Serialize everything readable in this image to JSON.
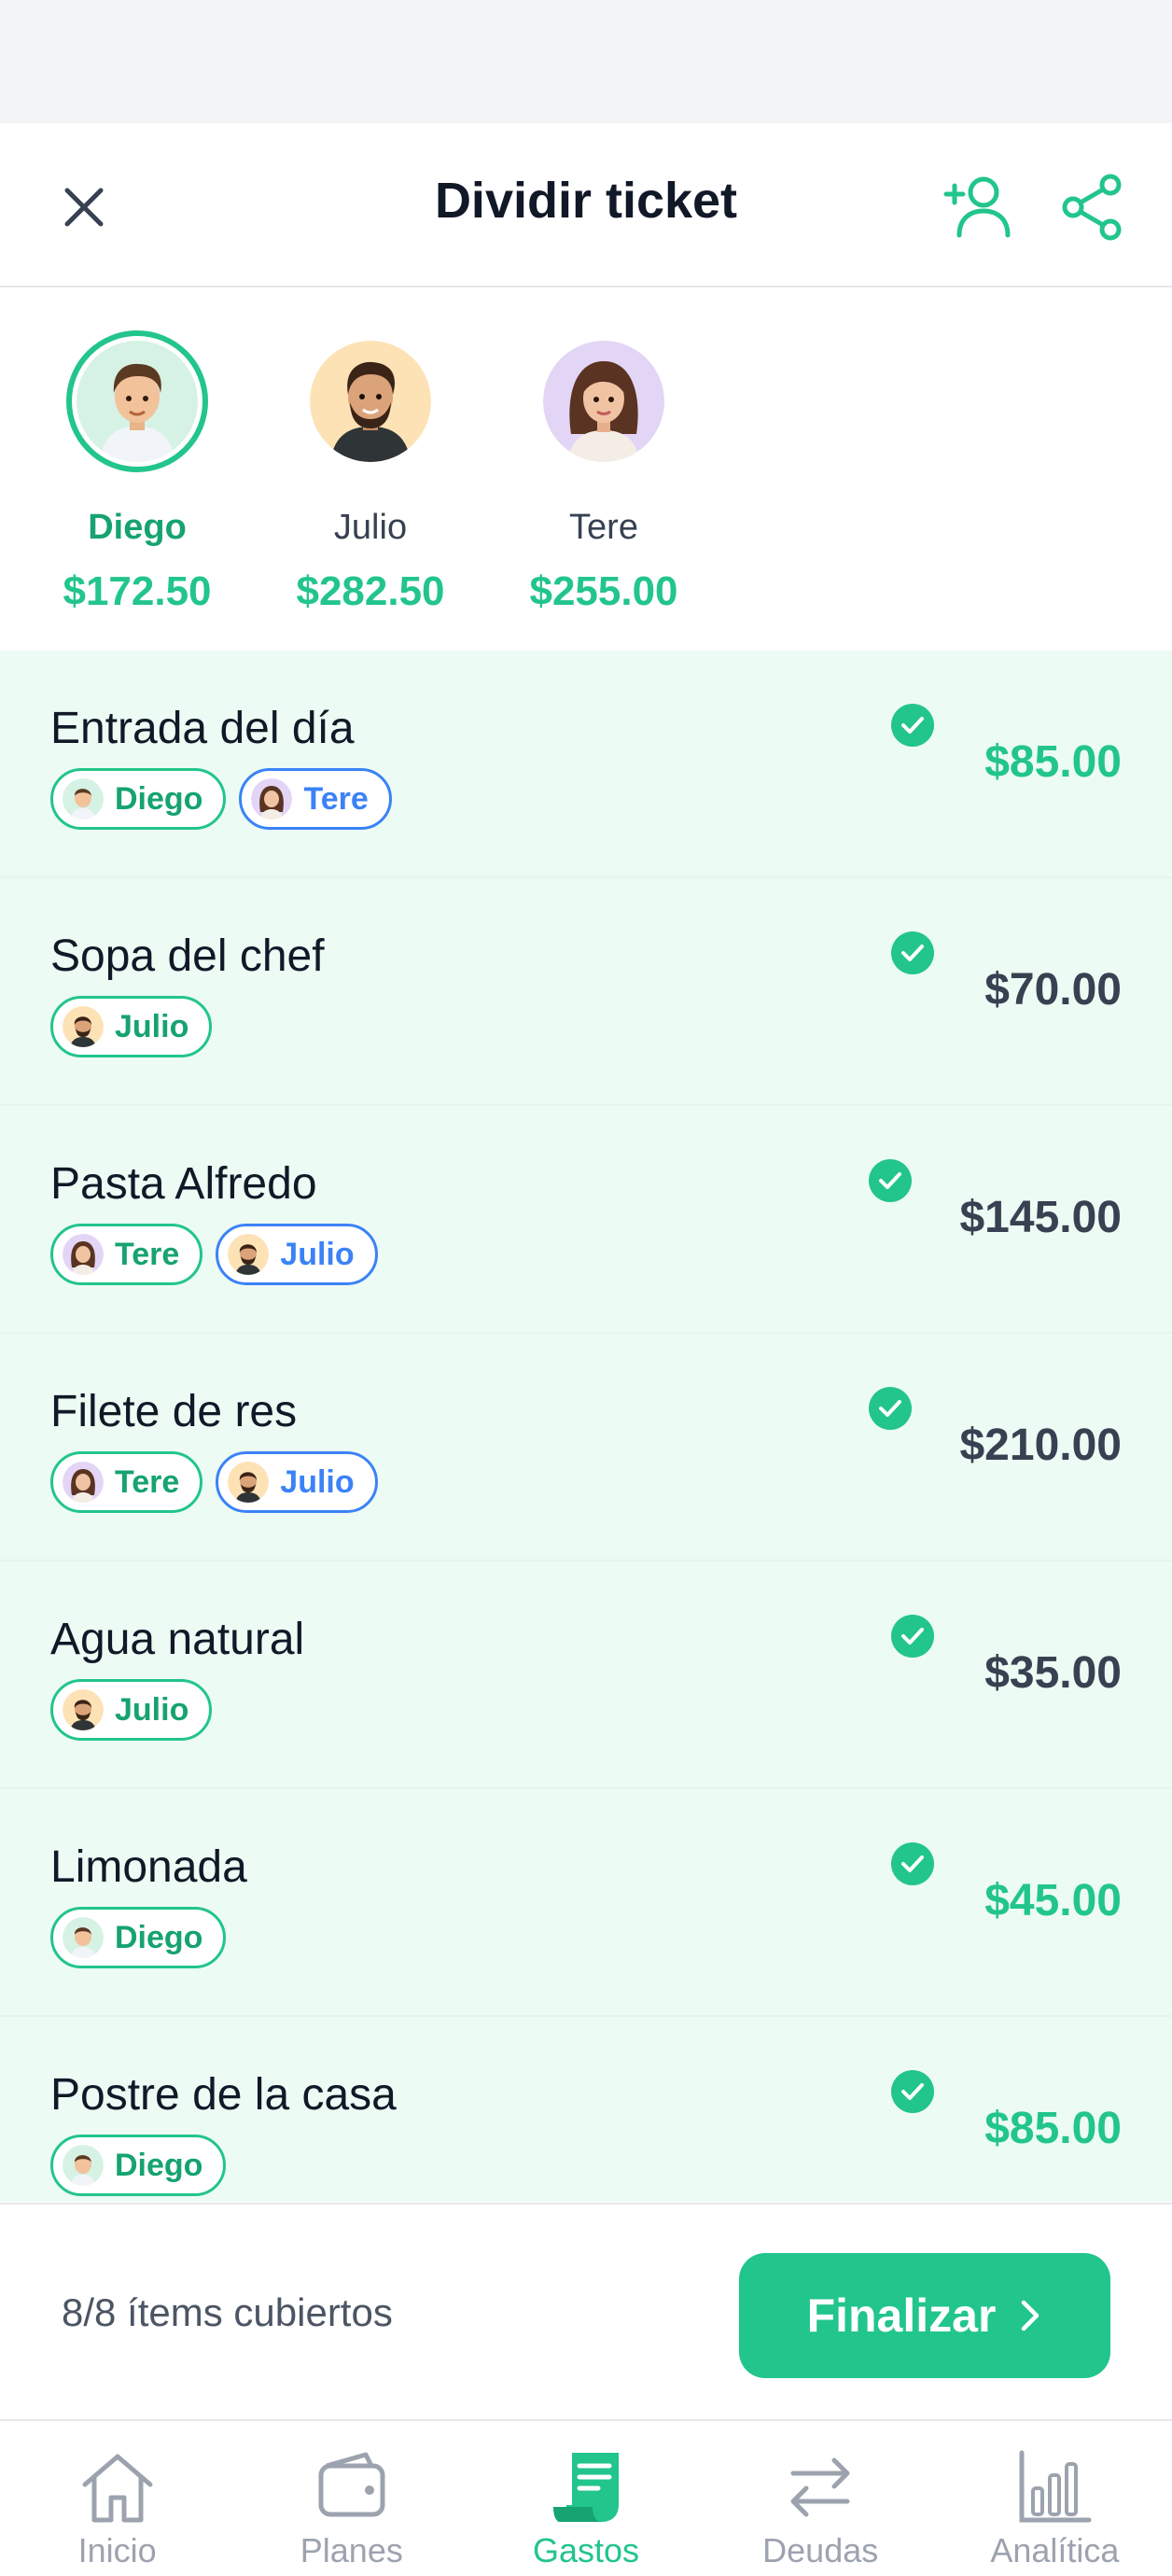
{
  "header": {
    "title": "Dividir ticket"
  },
  "people": [
    {
      "name": "Diego",
      "amount": "$172.50",
      "selected": true
    },
    {
      "name": "Julio",
      "amount": "$282.50",
      "selected": false
    },
    {
      "name": "Tere",
      "amount": "$255.00",
      "selected": false
    }
  ],
  "items": [
    {
      "name": "Entrada del día",
      "price": "$85.00",
      "chips": [
        "Diego",
        "Tere"
      ]
    },
    {
      "name": "Sopa del chef",
      "price": "$70.00",
      "chips": [
        "Julio"
      ]
    },
    {
      "name": "Pasta Alfredo",
      "price": "$145.00",
      "chips": [
        "Tere",
        "Julio"
      ]
    },
    {
      "name": "Filete de res",
      "price": "$210.00",
      "chips": [
        "Tere",
        "Julio"
      ]
    },
    {
      "name": "Agua natural",
      "price": "$35.00",
      "chips": [
        "Julio"
      ]
    },
    {
      "name": "Limonada",
      "price": "$45.00",
      "chips": [
        "Diego"
      ]
    },
    {
      "name": "Postre de la casa",
      "price": "$85.00",
      "chips": [
        "Diego"
      ]
    }
  ],
  "footer": {
    "covered": "8/8 ítems cubiertos",
    "finalize_label": "Finalizar"
  },
  "tabs": [
    {
      "label": "Inicio",
      "icon": "home-icon"
    },
    {
      "label": "Planes",
      "icon": "wallet-icon"
    },
    {
      "label": "Gastos",
      "icon": "receipt-icon",
      "active": true
    },
    {
      "label": "Deudas",
      "icon": "transfer-icon"
    },
    {
      "label": "Analítica",
      "icon": "bar-chart-icon"
    }
  ],
  "colors": {
    "accent": "#22c58b",
    "accent_dark": "#16a36f",
    "blue": "#3b82f6",
    "items_bg": "#ecfbf4"
  }
}
